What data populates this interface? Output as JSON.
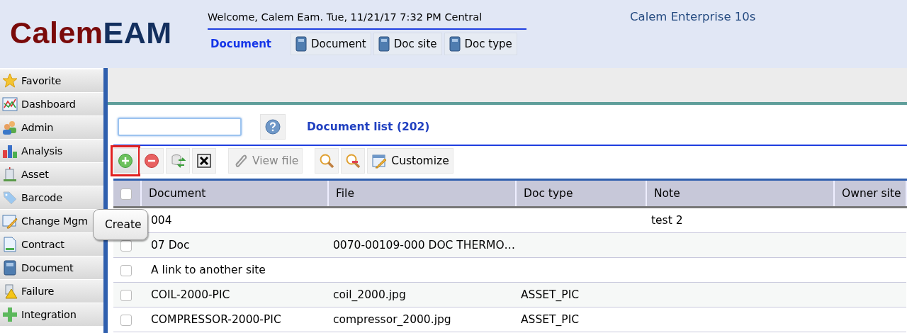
{
  "header": {
    "logo_parts": [
      "Calem",
      "EAM"
    ],
    "welcome": "Welcome, Calem Eam. Tue, 11/21/17 7:32 PM Central",
    "product": "Calem Enterprise 10s"
  },
  "module_tabs": {
    "title": "Document",
    "tabs": [
      {
        "label": "Document",
        "selected": false
      },
      {
        "label": "Doc site",
        "selected": false
      },
      {
        "label": "Doc type",
        "selected": false
      }
    ]
  },
  "sidebar": {
    "items": [
      {
        "label": "Favorite"
      },
      {
        "label": "Dashboard"
      },
      {
        "label": "Admin"
      },
      {
        "label": "Analysis"
      },
      {
        "label": "Asset"
      },
      {
        "label": "Barcode"
      },
      {
        "label": "Change Mgm"
      },
      {
        "label": "Contract"
      },
      {
        "label": "Document"
      },
      {
        "label": "Failure"
      },
      {
        "label": "Integration"
      }
    ]
  },
  "list": {
    "title": "Document list (202)"
  },
  "toolbar": [
    {
      "kind": "add",
      "highlighted": true
    },
    {
      "kind": "remove",
      "highlighted": false
    },
    {
      "kind": "refresh",
      "highlighted": false
    },
    {
      "kind": "clear",
      "highlighted": false
    },
    {
      "kind": "attach",
      "label": "View file",
      "disabled": true,
      "highlighted": false
    },
    {
      "kind": "search",
      "highlighted": false
    },
    {
      "kind": "search-clear",
      "highlighted": false
    },
    {
      "kind": "customize",
      "label": "Customize",
      "highlighted": false
    }
  ],
  "tooltip": "Create",
  "table": {
    "header_checked": false,
    "columns": [
      "Document",
      "File",
      "Doc type",
      "Note",
      "Owner site"
    ],
    "rows": [
      {
        "cells": [
          "004",
          "",
          "",
          "test 2",
          ""
        ]
      },
      {
        "checked": false,
        "cells": [
          "07 Doc",
          "0070-00109-000 DOC THERMO…",
          "",
          "",
          ""
        ]
      },
      {
        "checked": false,
        "cells": [
          "A link to another site",
          "",
          "",
          "",
          ""
        ]
      },
      {
        "checked": false,
        "cells": [
          "COIL-2000-PIC",
          "coil_2000.jpg",
          "ASSET_PIC",
          "",
          ""
        ]
      },
      {
        "checked": false,
        "cells": [
          "COMPRESSOR-2000-PIC",
          "compressor_2000.jpg",
          "ASSET_PIC",
          "",
          ""
        ]
      }
    ]
  }
}
